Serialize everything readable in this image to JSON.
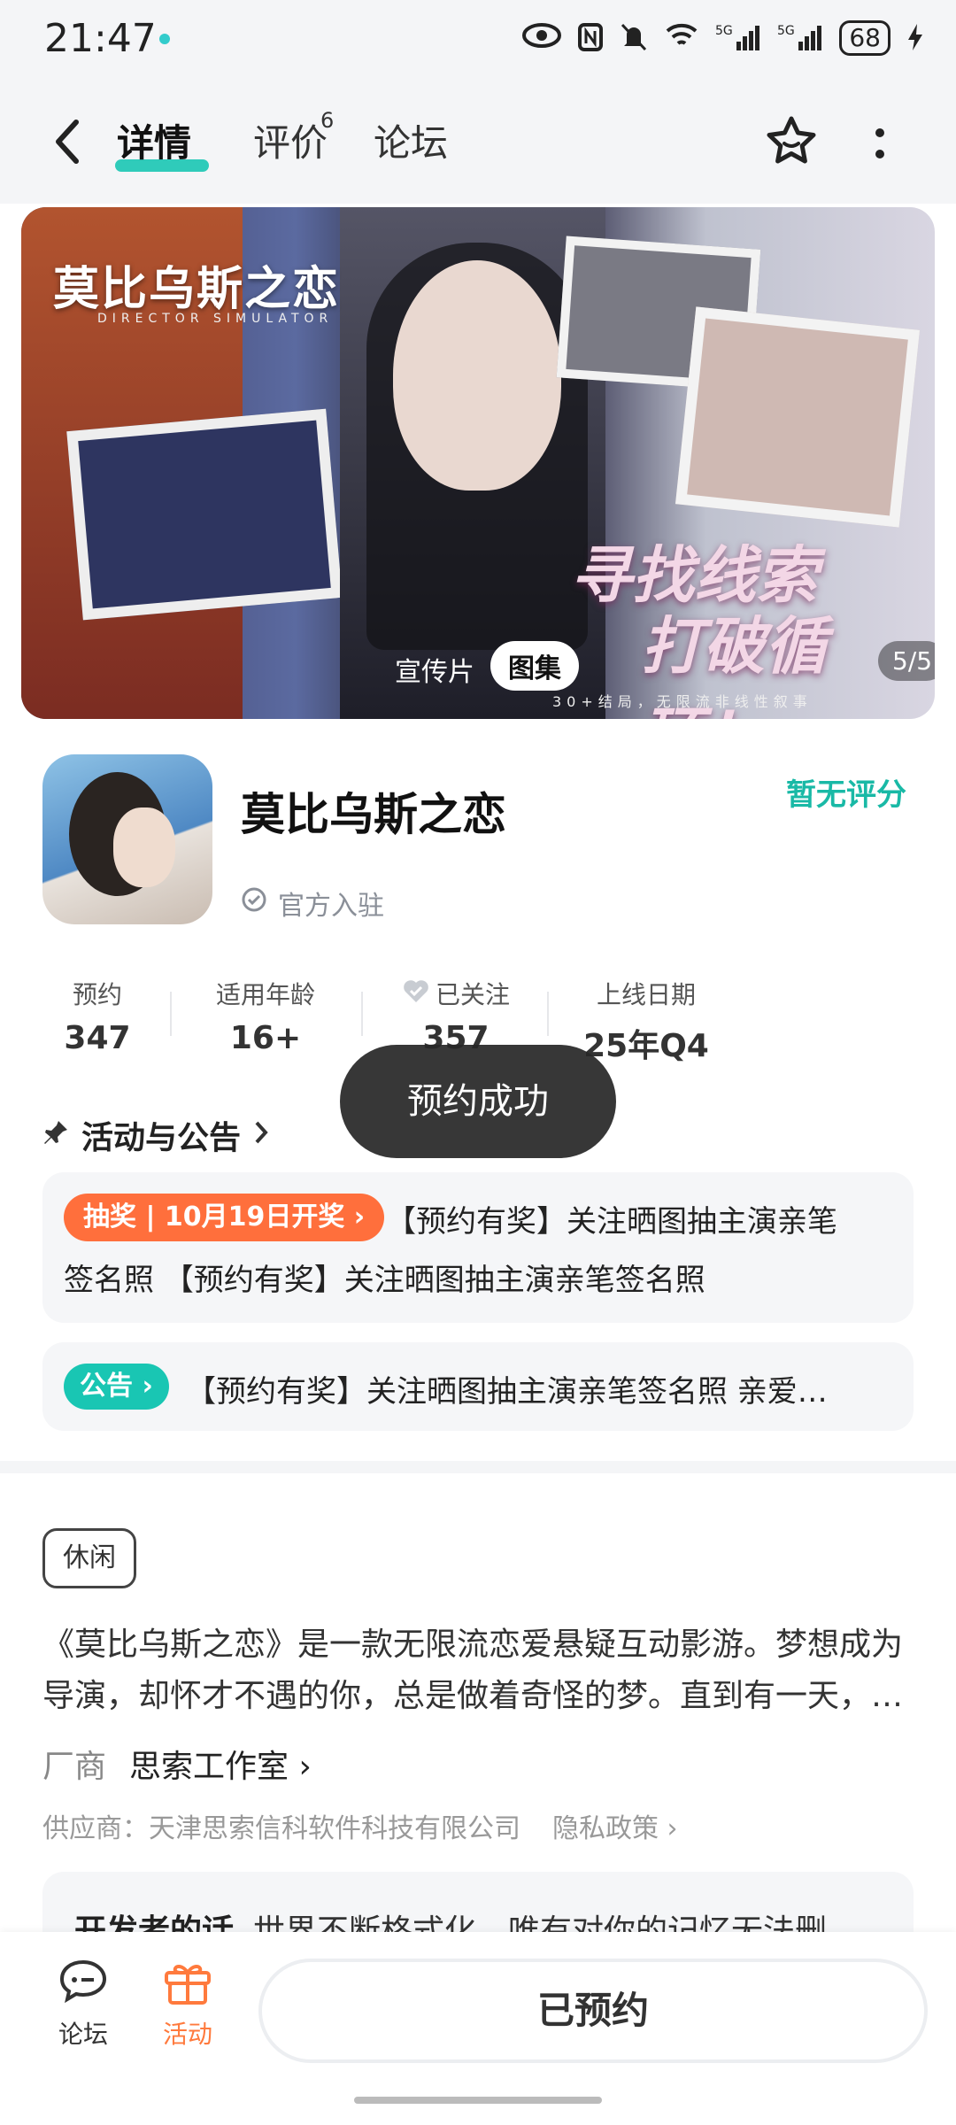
{
  "status_bar": {
    "time": "21:47",
    "battery": "68"
  },
  "header": {
    "tabs": [
      {
        "label": "详情",
        "active": true
      },
      {
        "label": "评价",
        "superscript": "6"
      },
      {
        "label": "论坛"
      }
    ]
  },
  "banner": {
    "title": "莫比乌斯之恋",
    "title_sub": "DIRECTOR SIMULATOR",
    "slogan_line1": "寻找线索",
    "slogan_line2": "打破循环！",
    "slogan_small": "30+结局，无限流非线性叙事",
    "video_label": "宣传片",
    "gallery_label": "图集",
    "pager": "5/5"
  },
  "game": {
    "title": "莫比乌斯之恋",
    "official": "官方入驻",
    "rating": "暂无评分"
  },
  "stats": [
    {
      "label": "预约",
      "value": "347"
    },
    {
      "label": "适用年龄",
      "value": "16+"
    },
    {
      "label": "已关注",
      "value": "357"
    },
    {
      "label": "上线日期",
      "value": "25年Q4"
    }
  ],
  "toast": "预约成功",
  "activities": {
    "heading": "活动与公告",
    "lottery_badge": "抽奖 | 10月19日开奖",
    "lottery_text_line1": "【预约有奖】关注晒图抽主演亲笔",
    "lottery_text_line2": "签名照 【预约有奖】关注晒图抽主演亲笔签名照",
    "notice_badge": "公告",
    "notice_text": "【预约有奖】关注晒图抽主演亲笔签名照 亲爱…"
  },
  "description": {
    "tag": "休闲",
    "line1": "《莫比乌斯之恋》是一款无限流恋爱悬疑互动影游。梦想成为",
    "line2": "导演，却怀才不遇的你，总是做着奇怪的梦。直到有一天，…",
    "vendor_label": "厂商",
    "vendor_name": "思索工作室",
    "supplier": "供应商：天津思索信科软件科技有限公司",
    "privacy": "隐私政策",
    "dev_label": "开发者的话",
    "dev_text": "世界不断格式化，唯有对你的记忆无法删"
  },
  "bottom_bar": {
    "forum_label": "论坛",
    "activity_label": "活动",
    "reserved_label": "已预约"
  },
  "colors": {
    "accent": "#19c6b3",
    "lottery": "#ff6f3c",
    "activity": "#ff7a3d"
  }
}
